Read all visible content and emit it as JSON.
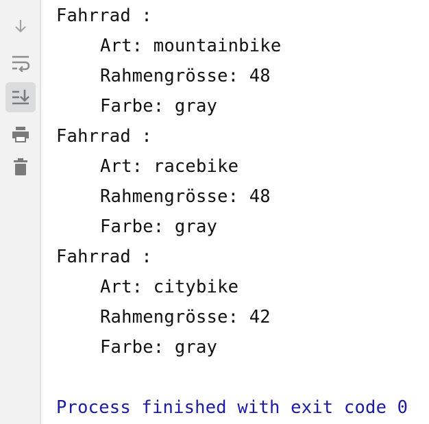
{
  "toolbar": {
    "icons": [
      "arrow-down-icon",
      "soft-wrap-icon",
      "scroll-to-end-icon",
      "print-icon",
      "trash-icon"
    ],
    "active": "scroll-to-end-icon",
    "icon_color": "#8c8c8c"
  },
  "console": {
    "lines": [
      {
        "text": "Fahrrad :",
        "indent": false
      },
      {
        "text": "Art: mountainbike",
        "indent": true
      },
      {
        "text": "Rahmengrösse: 48",
        "indent": true
      },
      {
        "text": "Farbe: gray",
        "indent": true
      },
      {
        "text": "Fahrrad :",
        "indent": false
      },
      {
        "text": "Art: racebike",
        "indent": true
      },
      {
        "text": "Rahmengrösse: 48",
        "indent": true
      },
      {
        "text": "Farbe: gray",
        "indent": true
      },
      {
        "text": "Fahrrad :",
        "indent": false
      },
      {
        "text": "Art: citybike",
        "indent": true
      },
      {
        "text": "Rahmengrösse: 42",
        "indent": true
      },
      {
        "text": "Farbe: gray",
        "indent": true
      }
    ],
    "process_message": "Process finished with exit code 0",
    "text_color": "#111111",
    "process_color": "#1a1aa6"
  }
}
